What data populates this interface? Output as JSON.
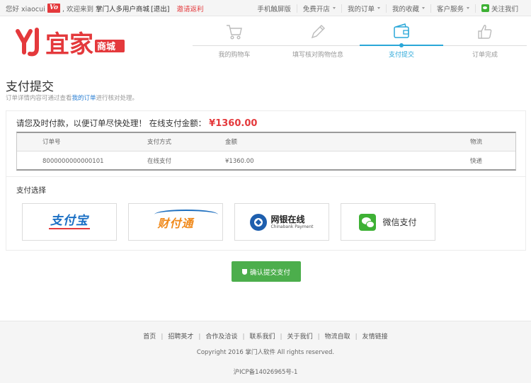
{
  "topbar": {
    "greeting": "您好 xiaocui",
    "vip_badge": "Vo",
    "welcome_prefix": ", 欢迎来到",
    "site_name": "掌门人多用户商城",
    "logout": "[退出]",
    "invite": "邀请返利",
    "right_items": [
      {
        "label": "手机触屏版",
        "has_caret": false
      },
      {
        "label": "免费开店",
        "has_caret": true
      },
      {
        "label": "我的订单",
        "has_caret": true
      },
      {
        "label": "我的收藏",
        "has_caret": true
      },
      {
        "label": "客户服务",
        "has_caret": true
      },
      {
        "label": "关注我们",
        "has_caret": false,
        "icon": "wechat-icon"
      }
    ]
  },
  "brand": {
    "logo_mark": "YJ",
    "logo_text": "宜家",
    "logo_tag": "商城",
    "color": "#e4393c"
  },
  "steps": [
    {
      "label": "我的购物车",
      "icon": "cart-icon",
      "active": false
    },
    {
      "label": "填写核对购物信息",
      "icon": "pencil-icon",
      "active": false
    },
    {
      "label": "支付提交",
      "icon": "wallet-icon",
      "active": true
    },
    {
      "label": "订单完成",
      "icon": "thumbs-up-icon",
      "active": false
    }
  ],
  "page": {
    "title": "支付提交",
    "subtitle_prefix": "订单详情内容可通过查看",
    "subtitle_link": "我的订单",
    "subtitle_suffix": "进行核对处理。"
  },
  "payment": {
    "message": "请您及时付款，以便订单尽快处理！ 在线支付金额：",
    "amount": "¥1360.00"
  },
  "order_table": {
    "headers": [
      "订单号",
      "支付方式",
      "金额",
      "物流"
    ],
    "rows": [
      [
        "8000000000000101",
        "在线支付",
        "¥1360.00",
        "快递"
      ]
    ]
  },
  "choose": {
    "title": "支付选择",
    "options": [
      {
        "name": "支付宝",
        "icon": "alipay-logo"
      },
      {
        "name": "财付通",
        "icon": "tenpay-logo"
      },
      {
        "name": "网银在线",
        "sub": "Chinabank Payment",
        "icon": "chinabank-logo"
      },
      {
        "name": "微信支付",
        "icon": "wechat-pay-logo"
      }
    ]
  },
  "confirm_button": "确认提交支付",
  "footer": {
    "links": [
      "首页",
      "招聘英才",
      "合作及洽谈",
      "联系我们",
      "关于我们",
      "物流自取",
      "友情链接"
    ],
    "copyright": "Copyright 2016 掌门人软件 All rights reserved.",
    "icp": "沪ICP备14026965号-1"
  },
  "colors": {
    "accent": "#2aa7d8",
    "price": "#e4393c",
    "confirm": "#4cae4c"
  }
}
